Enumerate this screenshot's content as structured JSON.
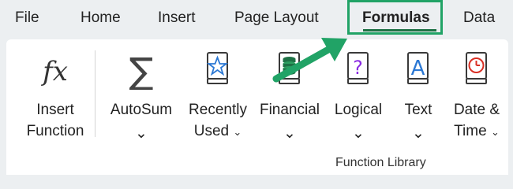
{
  "tabs": [
    {
      "label": "File"
    },
    {
      "label": "Home"
    },
    {
      "label": "Insert"
    },
    {
      "label": "Page Layout"
    },
    {
      "label": "Formulas"
    },
    {
      "label": "Data"
    }
  ],
  "active_tab": "Formulas",
  "ribbon": {
    "insert_function": {
      "line1": "Insert",
      "line2": "Function",
      "icon_text": "fx"
    },
    "autosum": {
      "line1": "AutoSum",
      "icon_text": "∑"
    },
    "recently_used": {
      "line1": "Recently",
      "line2": "Used"
    },
    "financial": {
      "line1": "Financial"
    },
    "logical": {
      "line1": "Logical",
      "icon_text": "?"
    },
    "text": {
      "line1": "Text",
      "icon_text": "A"
    },
    "date_time": {
      "line1": "Date &",
      "line2": "Time"
    },
    "group_label": "Function Library"
  },
  "colors": {
    "highlight_green": "#21a366",
    "arrow_green": "#21a366",
    "book_outline": "#3a3a3a",
    "financial_green": "#1e7145",
    "logical_purple": "#8a2be2",
    "text_blue": "#2b78d4",
    "date_red": "#d93025"
  },
  "icons": [
    "function-icon",
    "sigma-icon",
    "star-book-icon",
    "coins-book-icon",
    "question-book-icon",
    "letter-a-book-icon",
    "clock-book-icon",
    "chevron-down-icon"
  ]
}
